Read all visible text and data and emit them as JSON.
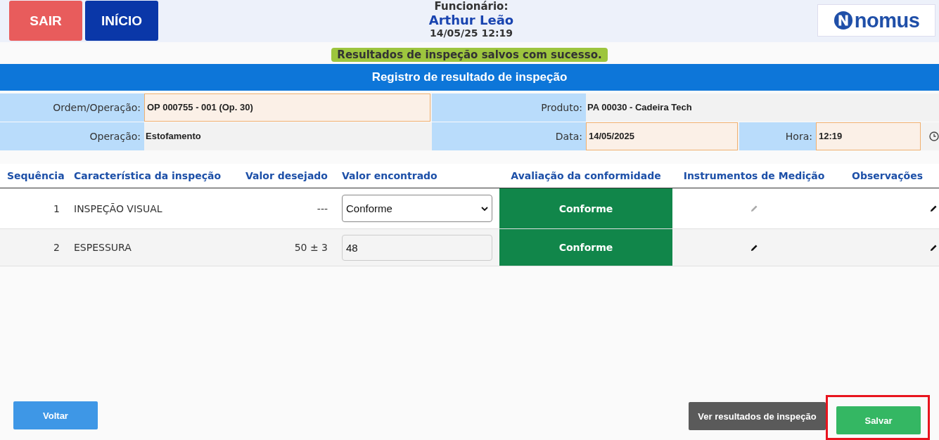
{
  "header": {
    "buttons": [
      {
        "label": "SAIR",
        "kind": "exit"
      },
      {
        "label": "INÍCIO",
        "kind": "home"
      }
    ],
    "employee_label": "Funcionário:",
    "employee_name": "Arthur Leão",
    "datetime": "14/05/25 12:19",
    "logo": "nomus"
  },
  "message": "Resultados de inspeção salvos com sucesso.",
  "title": "Registro de resultado de inspeção",
  "form": {
    "order_label": "Ordem/Operação:",
    "order_value": "OP 000755 - 001 (Op. 30)",
    "product_label": "Produto:",
    "product_value": "PA 00030 - Cadeira Tech",
    "operation_label": "Operação:",
    "operation_value": "Estofamento",
    "date_label": "Data:",
    "date_value": "14/05/2025",
    "time_label": "Hora:",
    "time_value": "12:19"
  },
  "table": {
    "columns": [
      "Sequência",
      "Característica da inspeção",
      "Valor desejado",
      "Valor encontrado",
      "Avaliação da conformidade",
      "Instrumentos de Medição",
      "Observações"
    ],
    "rows": [
      {
        "sequence": "1",
        "characteristic": "INSPEÇÃO VISUAL",
        "desired": "---",
        "found": "Conforme",
        "kind": "select",
        "evaluation": "Conforme",
        "instrument_edit_enabled": false
      },
      {
        "sequence": "2",
        "characteristic": "ESPESSURA",
        "desired": "50 ± 3",
        "found": "48",
        "kind": "input",
        "evaluation": "Conforme",
        "instrument_edit_enabled": true
      }
    ]
  },
  "footer": {
    "back": "Voltar",
    "view_results": "Ver resultados de inspeção",
    "save": "Salvar",
    "save_highlighted": true
  }
}
